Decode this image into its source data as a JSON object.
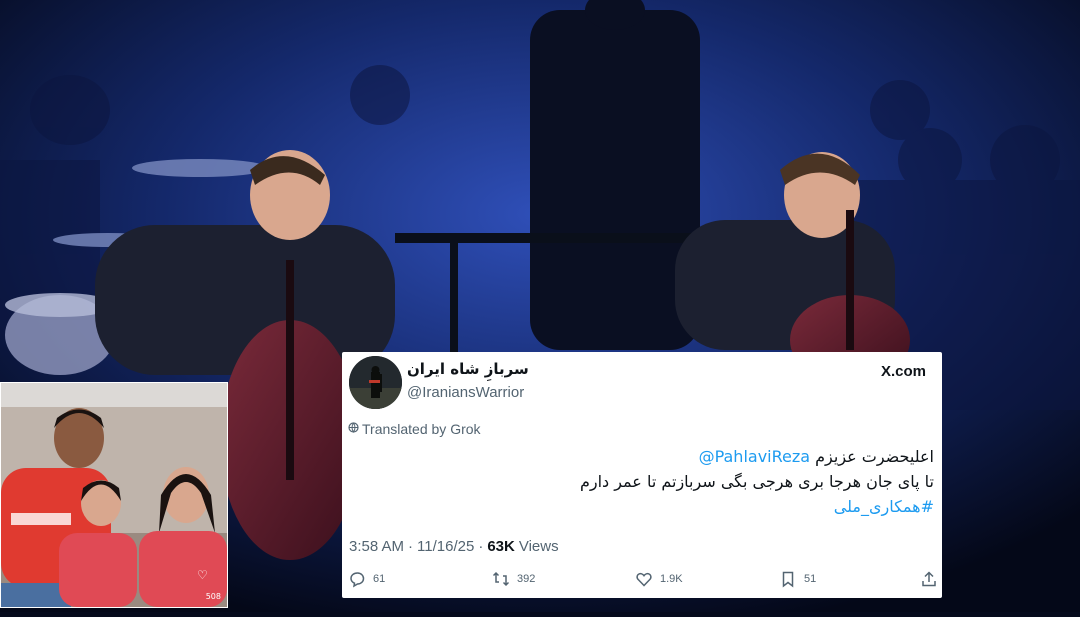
{
  "tweet": {
    "display_name": "سربازِ شاه ایران",
    "handle": "@IraniansWarrior",
    "source_brand": "X.com",
    "translated_label": "Translated by Grok",
    "body": {
      "mention": "@PahlaviReza",
      "line1_text": "اعلیحضرت عزیزم",
      "line2": "تا پای جان هرجا بری هرجی بگی سربازتم تا عمر دارم",
      "hashtag": "#همکاری_ملی"
    },
    "time": "3:58 AM",
    "separator": "·",
    "date": "11/16/25",
    "views_count": "63K",
    "views_label": "Views",
    "actions": {
      "replies": "61",
      "reposts": "392",
      "likes": "1.9K",
      "bookmarks": "51"
    },
    "icons": {
      "avatar": "soldier-avatar-icon",
      "globe": "globe-icon",
      "reply": "reply-icon",
      "repost": "repost-icon",
      "like": "like-icon",
      "bookmark": "bookmark-icon",
      "share": "share-icon"
    },
    "colors": {
      "link": "#1d9bf0",
      "muted": "#536471",
      "text": "#0f1419"
    }
  },
  "family_photo": {
    "counter": "508"
  }
}
